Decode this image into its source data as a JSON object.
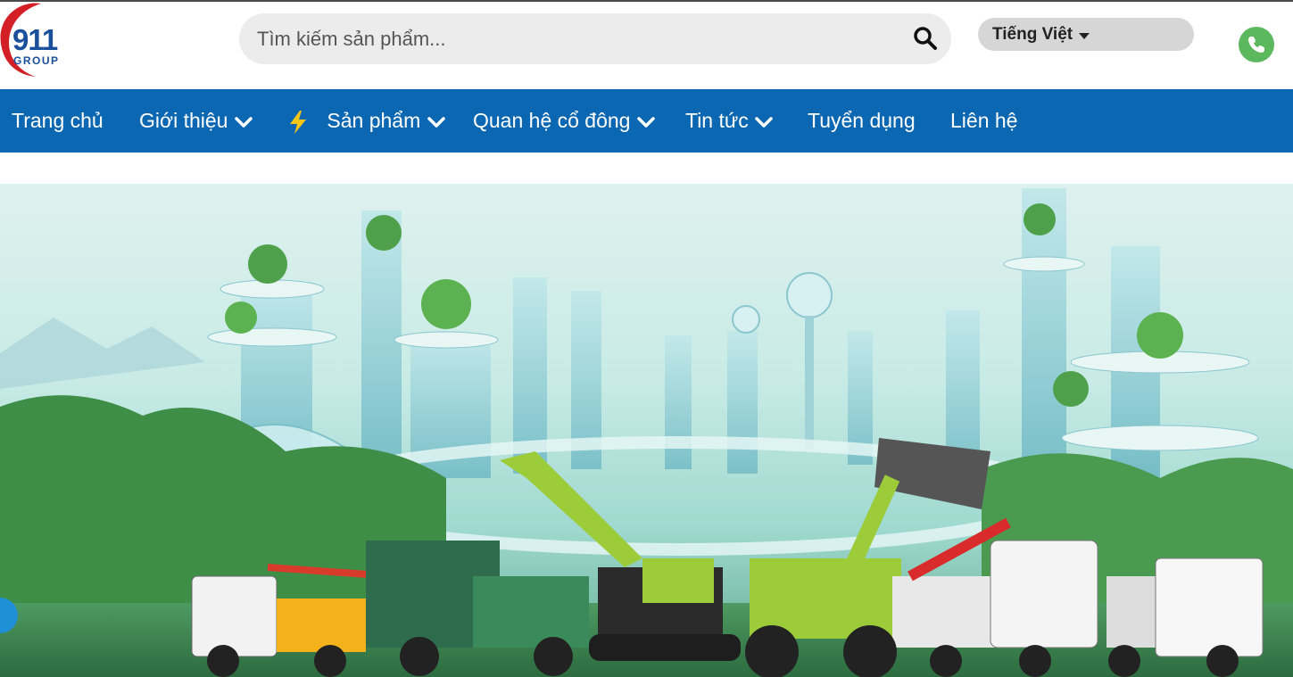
{
  "logo": {
    "number": "911",
    "group": "GROUP"
  },
  "search": {
    "placeholder": "Tìm kiếm sản phẩm..."
  },
  "language": {
    "selected": "Tiếng Việt"
  },
  "nav": {
    "items": [
      {
        "label": "Trang chủ"
      },
      {
        "label": "Giới thiệu"
      },
      {
        "label": "Sản phẩm"
      },
      {
        "label": "Quan hệ cổ đông"
      },
      {
        "label": "Tin tức"
      },
      {
        "label": "Tuyển dụng"
      },
      {
        "label": "Liên hệ"
      }
    ]
  },
  "colors": {
    "nav_bg": "#0b67b2",
    "brand_blue": "#1a4f9c",
    "brand_red": "#d32027",
    "phone_green": "#5cb85c",
    "bolt_yellow": "#f5c518"
  }
}
